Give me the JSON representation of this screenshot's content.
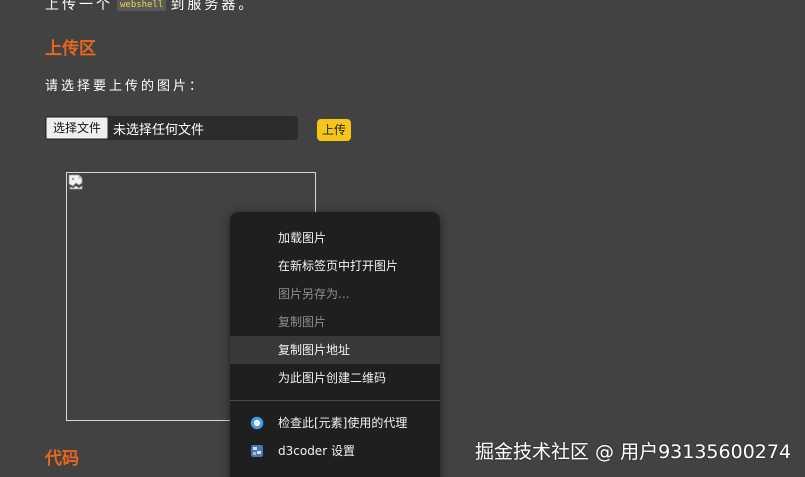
{
  "intro": {
    "prefix": "上传一个",
    "code": "webshell",
    "suffix": "到服务器。"
  },
  "upload_section": {
    "title": "上传区",
    "prompt": "请选择要上传的图片：",
    "choose_file_label": "选择文件",
    "file_status": "未选择任何文件",
    "upload_label": "上传"
  },
  "preview": {
    "image_state": "broken-image-icon"
  },
  "context_menu": {
    "items": [
      {
        "label": "加载图片",
        "state": "enabled"
      },
      {
        "label": "在新标签页中打开图片",
        "state": "enabled"
      },
      {
        "label": "图片另存为...",
        "state": "disabled"
      },
      {
        "label": "复制图片",
        "state": "disabled"
      },
      {
        "label": "复制图片地址",
        "state": "highlighted"
      },
      {
        "label": "为此图片创建二维码",
        "state": "enabled"
      }
    ],
    "extension_items": [
      {
        "label": "检查此[元素]使用的代理",
        "icon": "proxy-circle-icon"
      },
      {
        "label": "d3coder 设置",
        "icon": "d3coder-icon"
      }
    ]
  },
  "code_section": {
    "title": "代码"
  },
  "watermark": "掘金技术社区 @ 用户93135600274",
  "colors": {
    "background": "#424242",
    "section_title": "#e8661e",
    "upload_button": "#f5c518",
    "menu_background": "#1f1f1f",
    "menu_highlight": "#383838",
    "code_text": "#f0d64a"
  }
}
